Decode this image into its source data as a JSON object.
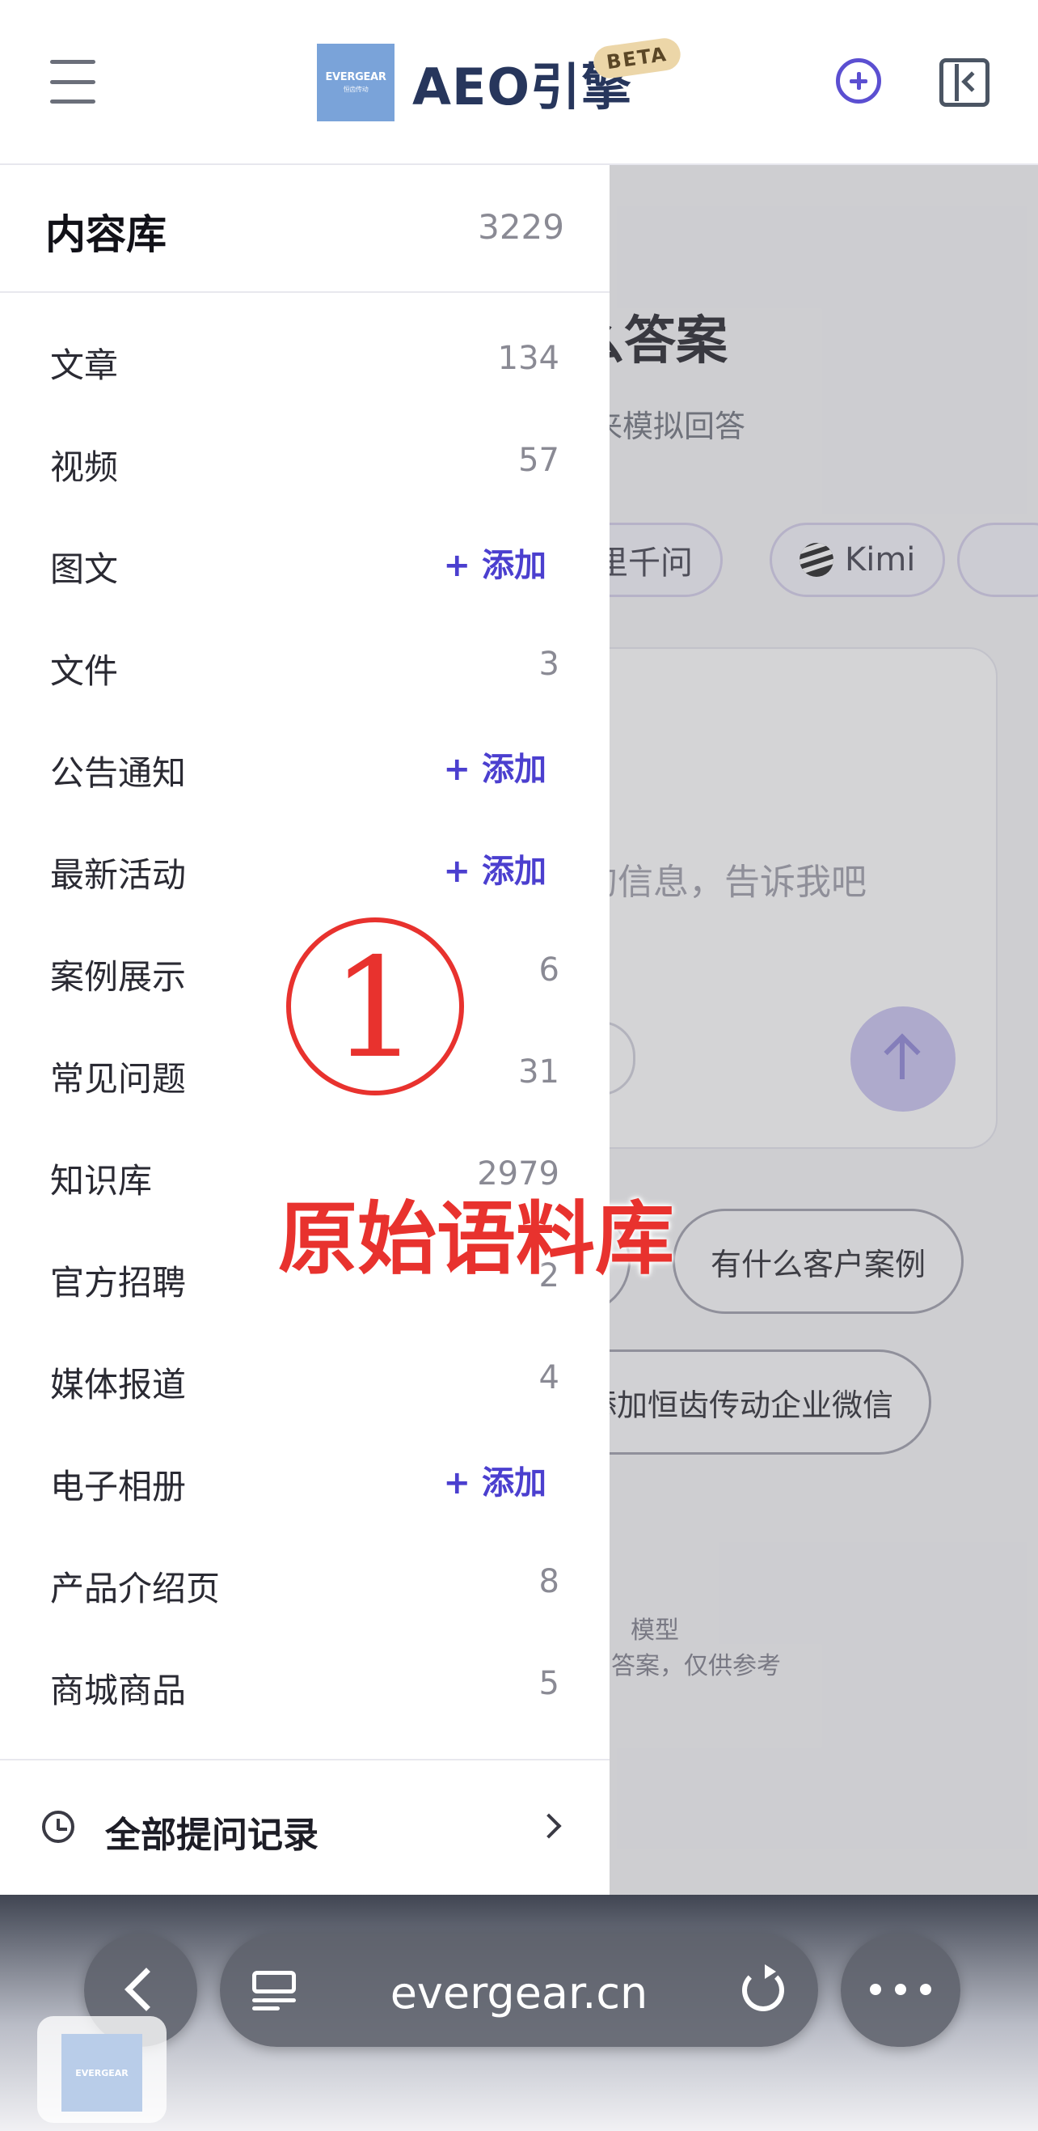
{
  "header": {
    "logo_text": "EVERGEAR",
    "logo_subtext": "恒齿传动",
    "brand": "AEO引擎",
    "beta_badge": "BETA"
  },
  "main": {
    "hero_title": "出什么答案",
    "hero_subtitle": "网信息，来模拟回答",
    "model_chips": [
      "阿里千问",
      "Kimi"
    ],
    "input_placeholder": "的信息，告诉我吧",
    "suggestions": [
      "有什么客户案例",
      "么添加恒齿传动企业微信"
    ],
    "footnotes": [
      "模型",
      "答案，仅供参考"
    ]
  },
  "drawer": {
    "title": "内容库",
    "total": "3229",
    "add_label": "+ 添加",
    "items": [
      {
        "label": "文章",
        "count": "134"
      },
      {
        "label": "视频",
        "count": "57"
      },
      {
        "label": "图文",
        "count": ""
      },
      {
        "label": "文件",
        "count": "3"
      },
      {
        "label": "公告通知",
        "count": ""
      },
      {
        "label": "最新活动",
        "count": ""
      },
      {
        "label": "案例展示",
        "count": "6"
      },
      {
        "label": "常见问题",
        "count": "31"
      },
      {
        "label": "知识库",
        "count": "2979"
      },
      {
        "label": "官方招聘",
        "count": "2"
      },
      {
        "label": "媒体报道",
        "count": "4"
      },
      {
        "label": "电子相册",
        "count": ""
      },
      {
        "label": "产品介绍页",
        "count": "8"
      },
      {
        "label": "商城商品",
        "count": "5"
      }
    ],
    "footer_label": "全部提问记录"
  },
  "annotation": {
    "number": "1",
    "text": "原始语料库",
    "color": "#e8322e"
  },
  "browser": {
    "url": "evergear.cn"
  },
  "colors": {
    "accent": "#5b4fd1",
    "brand_text": "#27365c"
  }
}
